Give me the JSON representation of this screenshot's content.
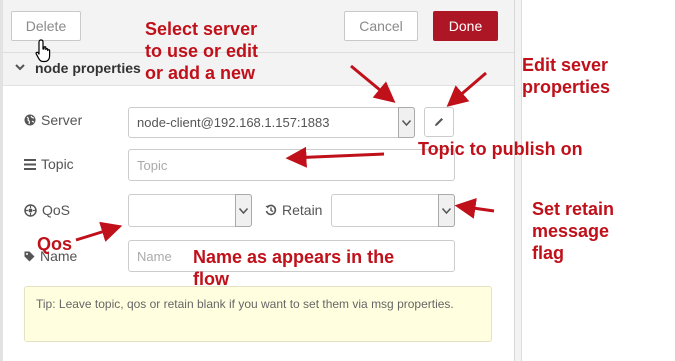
{
  "toolbar": {
    "delete_label": "Delete",
    "cancel_label": "Cancel",
    "done_label": "Done"
  },
  "section": {
    "title": "node properties"
  },
  "form": {
    "server": {
      "label": "Server",
      "value": "node-client@192.168.1.157:1883"
    },
    "topic": {
      "label": "Topic",
      "placeholder": "Topic"
    },
    "qos": {
      "label": "QoS",
      "value": ""
    },
    "retain": {
      "label": "Retain",
      "value": ""
    },
    "name": {
      "label": "Name",
      "placeholder": "Name"
    }
  },
  "tip": "Tip: Leave topic, qos or retain blank if you want to set them via msg properties.",
  "annotations": {
    "server_l1": "Select server",
    "server_l2": "to use or edit",
    "server_l3": "or add a new",
    "edit_l1": "Edit sever",
    "edit_l2": "properties",
    "topic": "Topic to publish on",
    "retain_l1": "Set retain",
    "retain_l2": "message",
    "retain_l3": "flag",
    "qos": "Qos",
    "name_l1": "Name as appears in the",
    "name_l2": "flow"
  },
  "colors": {
    "accent": "#ad1625",
    "annotation": "#c0101a",
    "tip_bg": "#ffffe0"
  },
  "icons": [
    "globe-icon",
    "list-icon",
    "qos-icon",
    "history-icon",
    "tag-icon",
    "pencil-icon",
    "caret-down-icon",
    "chevron-down-icon",
    "hand-cursor-icon"
  ]
}
